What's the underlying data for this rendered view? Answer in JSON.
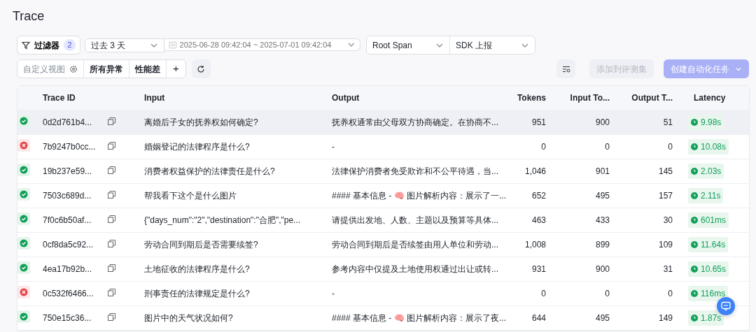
{
  "title": "Trace",
  "filters": {
    "filter_button": {
      "label": "过滤器",
      "count": "2"
    },
    "time_range": "过去 3 天",
    "date_range": {
      "placeholder": "2025-06-28 09:42:04 ~ 2025-07-01 09:42:04"
    },
    "span_type": "Root Span",
    "source": "SDK 上报"
  },
  "views": {
    "custom_view": "自定义视图",
    "tabs": [
      {
        "label": "所有异常",
        "selected": false
      },
      {
        "label": "性能差",
        "selected": false
      }
    ],
    "add": "+"
  },
  "actions": [
    {
      "label": "添加到评测集",
      "kind": "secondary",
      "disabled": true
    },
    {
      "label": "创建自动化任务",
      "kind": "primary",
      "disabled": true
    }
  ],
  "table": {
    "columns": [
      "Trace ID",
      "Input",
      "Output",
      "Tokens",
      "Input To...",
      "Output T...",
      "Latency"
    ],
    "rows": [
      {
        "kind": "success",
        "trace_id": "0d2d761b4...",
        "input": "离婚后子女的抚养权如何确定?",
        "output": "抚养权通常由父母双方协商确定。在协商不...",
        "tokens": "951",
        "input_tokens": "900",
        "output_tokens": "51",
        "latency": "9.98s",
        "selected": true
      },
      {
        "kind": "error",
        "trace_id": "7b9247b0cc...",
        "input": "婚姻登记的法律程序是什么?",
        "output": "-",
        "tokens": "0",
        "input_tokens": "0",
        "output_tokens": "0",
        "latency": "10.08s",
        "selected": false
      },
      {
        "kind": "success",
        "trace_id": "19b237e59...",
        "input": "消费者权益保护的法律责任是什么?",
        "output": "法律保护消费者免受欺诈和不公平待遇，当...",
        "tokens": "1,046",
        "input_tokens": "901",
        "output_tokens": "145",
        "latency": "2.03s",
        "selected": false
      },
      {
        "kind": "success",
        "trace_id": "7503c689d...",
        "input": "帮我看下这个是什么图片",
        "output": "#### 基本信息 - 🧠 图片解析内容：展示了一...",
        "tokens": "652",
        "input_tokens": "495",
        "output_tokens": "157",
        "latency": "2.11s",
        "selected": false
      },
      {
        "kind": "success",
        "trace_id": "7f0c6b50af...",
        "input": "{\"days_num\":\"2\",\"destination\":\"合肥\",\"pe...",
        "output": "请提供出发地、人数、主题以及预算等具体...",
        "tokens": "463",
        "input_tokens": "433",
        "output_tokens": "30",
        "latency": "601ms",
        "selected": false
      },
      {
        "kind": "success",
        "trace_id": "0cf8da5c92...",
        "input": "劳动合同到期后是否需要续签?",
        "output": "劳动合同到期后是否续签由用人单位和劳动...",
        "tokens": "1,008",
        "input_tokens": "899",
        "output_tokens": "109",
        "latency": "11.64s",
        "selected": false
      },
      {
        "kind": "success",
        "trace_id": "4ea17b92b...",
        "input": "土地征收的法律程序是什么?",
        "output": "参考内容中仅提及土地使用权通过出让或转...",
        "tokens": "931",
        "input_tokens": "900",
        "output_tokens": "31",
        "latency": "10.65s",
        "selected": false
      },
      {
        "kind": "error",
        "trace_id": "0c532f6466...",
        "input": "刑事责任的法律规定是什么?",
        "output": "-",
        "tokens": "0",
        "input_tokens": "0",
        "output_tokens": "0",
        "latency": "116ms",
        "selected": false
      },
      {
        "kind": "success",
        "trace_id": "750e15c36...",
        "input": "图片中的天气状况如何?",
        "output": "#### 基本信息 - 🧠 图片解析内容：展示了夜...",
        "tokens": "644",
        "input_tokens": "495",
        "output_tokens": "149",
        "latency": "1.87s",
        "selected": false
      }
    ]
  }
}
